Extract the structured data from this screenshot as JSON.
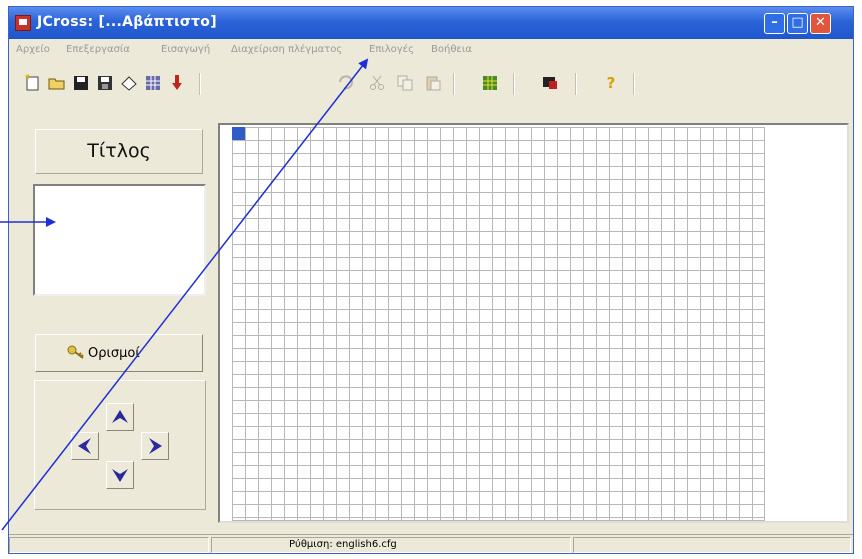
{
  "window": {
    "title": "JCross: [...Αβάπτιστο]"
  },
  "menu": {
    "items": [
      "Αρχείο",
      "Επεξεργασία",
      "Εισαγωγή",
      "Διαχείριση πλέγματος",
      "Επιλογές",
      "Βοήθεια"
    ]
  },
  "toolbar": {
    "icons": [
      "new-icon",
      "open-icon",
      "save-icon",
      "save-as-icon",
      "eraser-icon",
      "grid-icon",
      "export-icon",
      "undo-icon",
      "cut-icon",
      "copy-icon",
      "paste-icon",
      "crossword-icon",
      "preview-icon",
      "help-icon"
    ],
    "help_glyph": "?"
  },
  "left_panel": {
    "title_label": "Τίτλος",
    "definitions_button": "Ορισμοί"
  },
  "grid": {
    "columns": 41,
    "rows": 30,
    "cursor_color": "#2f5cc7"
  },
  "status": {
    "config": "Ρύθμιση: english6.cfg"
  },
  "colors": {
    "titlebar": "#2b63d8",
    "window_bg": "#ece9d8",
    "annotation_arrow": "#1e2fd6",
    "direction_arrow": "#2a2a9a"
  }
}
